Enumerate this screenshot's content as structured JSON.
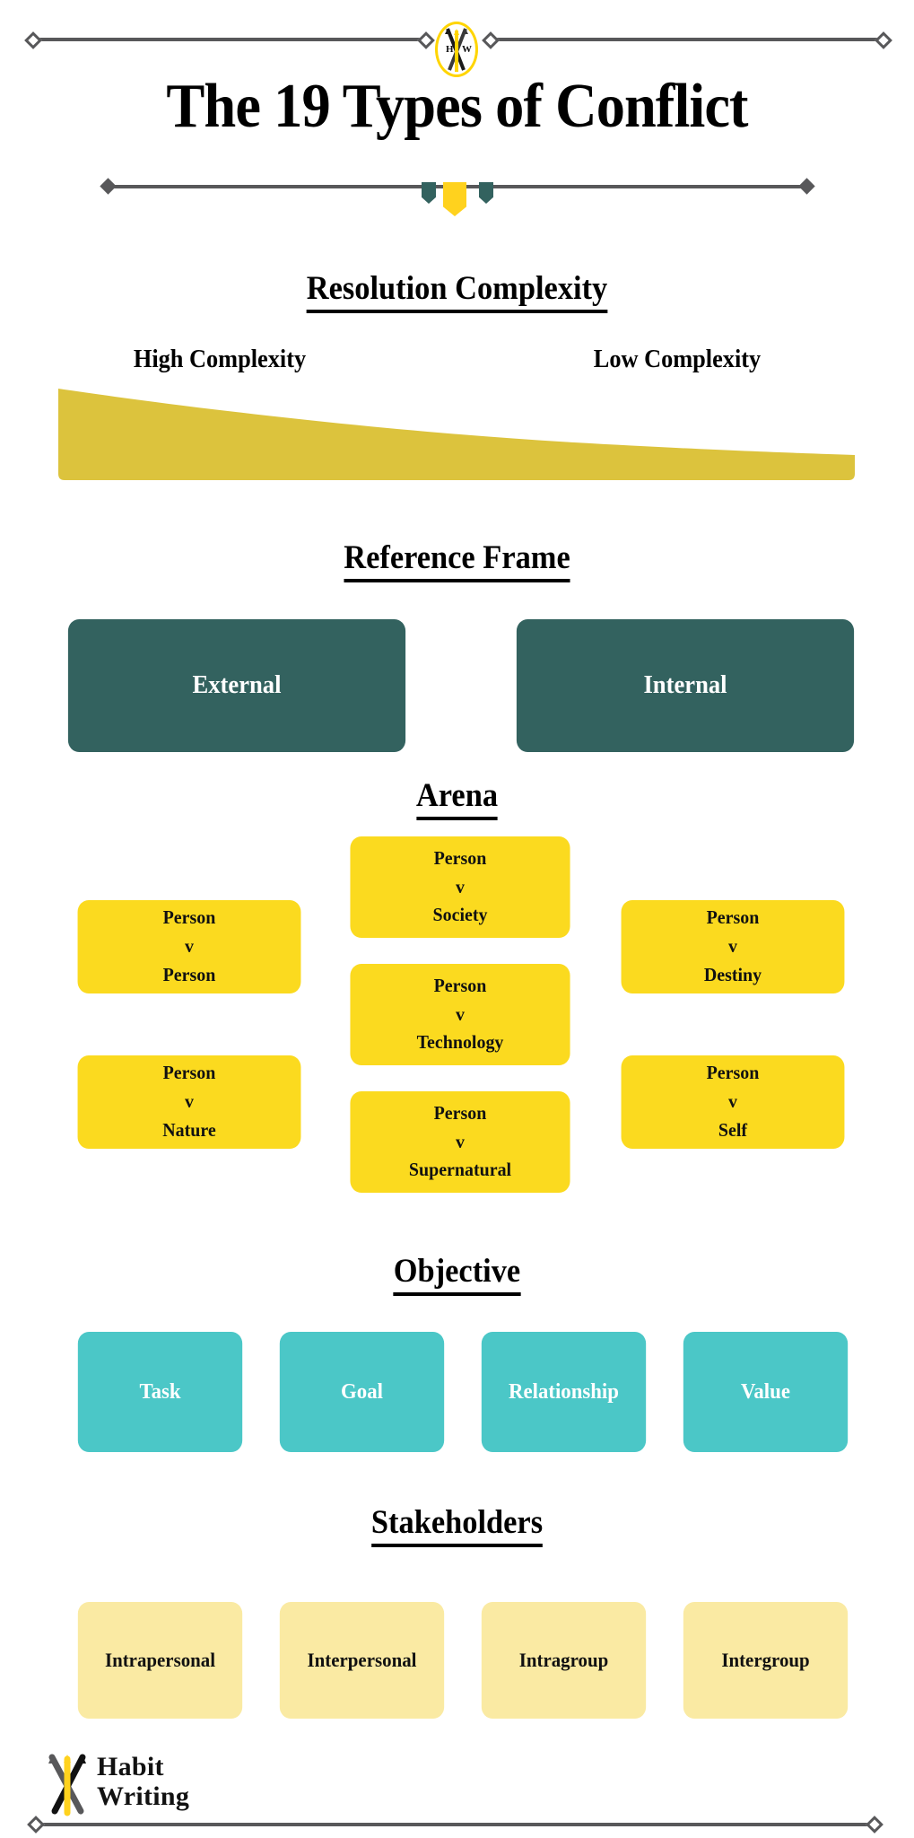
{
  "header": {
    "logo_icon": "crossed-pens-badge-icon",
    "logo_initials_left": "H",
    "logo_initials_right": "W",
    "title": "The 19 Types of Conflict",
    "divider_icon": "pennant-divider-ornament"
  },
  "sections": {
    "resolution": {
      "heading": "Resolution Complexity",
      "left_label": "High Complexity",
      "right_label": "Low Complexity",
      "wedge_color": "#DCC33D"
    },
    "reference_frame": {
      "heading": "Reference Frame",
      "card_color": "#33625F",
      "cards": [
        {
          "label": "External"
        },
        {
          "label": "Internal"
        }
      ]
    },
    "arena": {
      "heading": "Arena",
      "card_color": "#FBDA1F",
      "cards": [
        {
          "a": "Person",
          "v": "v",
          "b": "Person"
        },
        {
          "a": "Person",
          "v": "v",
          "b": "Nature"
        },
        {
          "a": "Person",
          "v": "v",
          "b": "Society"
        },
        {
          "a": "Person",
          "v": "v",
          "b": "Technology"
        },
        {
          "a": "Person",
          "v": "v",
          "b": "Supernatural"
        },
        {
          "a": "Person",
          "v": "v",
          "b": "Destiny"
        },
        {
          "a": "Person",
          "v": "v",
          "b": "Self"
        }
      ]
    },
    "objective": {
      "heading": "Objective",
      "card_color": "#4BC7C7",
      "cards": [
        {
          "label": "Task"
        },
        {
          "label": "Goal"
        },
        {
          "label": "Relationship"
        },
        {
          "label": "Value"
        }
      ]
    },
    "stakeholders": {
      "heading": "Stakeholders",
      "card_color": "#FAEAA3",
      "cards": [
        {
          "label": "Intrapersonal"
        },
        {
          "label": "Interpersonal"
        },
        {
          "label": "Intragroup"
        },
        {
          "label": "Intergroup"
        }
      ]
    }
  },
  "footer": {
    "logo_icon": "crossed-pens-icon",
    "brand_line1": "Habit",
    "brand_line2": "Writing"
  },
  "chart_data": {
    "type": "area",
    "title": "Resolution Complexity",
    "categories": [
      "High Complexity",
      "Low Complexity"
    ],
    "values": [
      100,
      18
    ],
    "xlabel": "",
    "ylabel": "",
    "ylim": [
      0,
      100
    ],
    "note": "Tapering wedge: thickness decreases left-to-right indicating complexity decreasing from High to Low"
  }
}
